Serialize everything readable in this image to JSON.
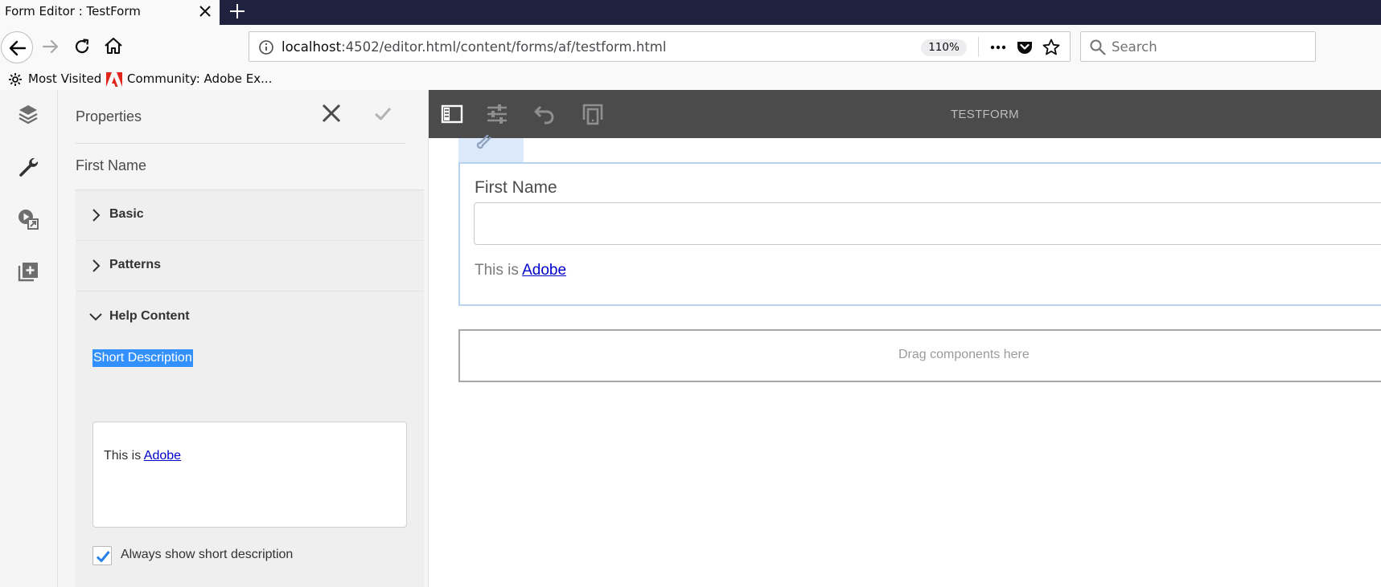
{
  "browser": {
    "tab_title": "Form Editor : TestForm",
    "url_host": "localhost",
    "url_rest": ":4502/editor.html/content/forms/af/testform.html",
    "zoom": "110%",
    "search_placeholder": "Search",
    "bookmarks": [
      {
        "label": "Most Visited",
        "icon": "gear-icon"
      },
      {
        "label": "Community: Adobe Ex...",
        "icon": "adobe-icon"
      }
    ]
  },
  "editor": {
    "side_rail": [
      "layers-icon",
      "wrench-icon",
      "media-icon",
      "add-component-icon"
    ],
    "properties": {
      "title": "Properties",
      "component_name": "First Name",
      "sections": [
        {
          "label": "Basic",
          "expanded": false
        },
        {
          "label": "Patterns",
          "expanded": false
        },
        {
          "label": "Help Content",
          "expanded": true
        }
      ],
      "short_description_label": "Short Description",
      "short_description_prefix": "This is ",
      "short_description_link": "Adobe",
      "always_show_label": "Always show short description",
      "always_show_checked": true
    },
    "toolbar": {
      "icons": [
        "panel-toggle-icon",
        "settings-sliders-icon",
        "undo-icon",
        "device-preview-icon"
      ],
      "form_title": "TESTFORM"
    },
    "canvas": {
      "field_label": "First Name",
      "field_value": "",
      "help_prefix": "This is ",
      "help_link": "Adobe",
      "drop_zone_text": "Drag components here"
    }
  },
  "colors": {
    "tabbar": "#202340",
    "toolbar": "#4b4b4b",
    "selection": "#3390ff",
    "checkbox_accent": "#2680eb"
  }
}
